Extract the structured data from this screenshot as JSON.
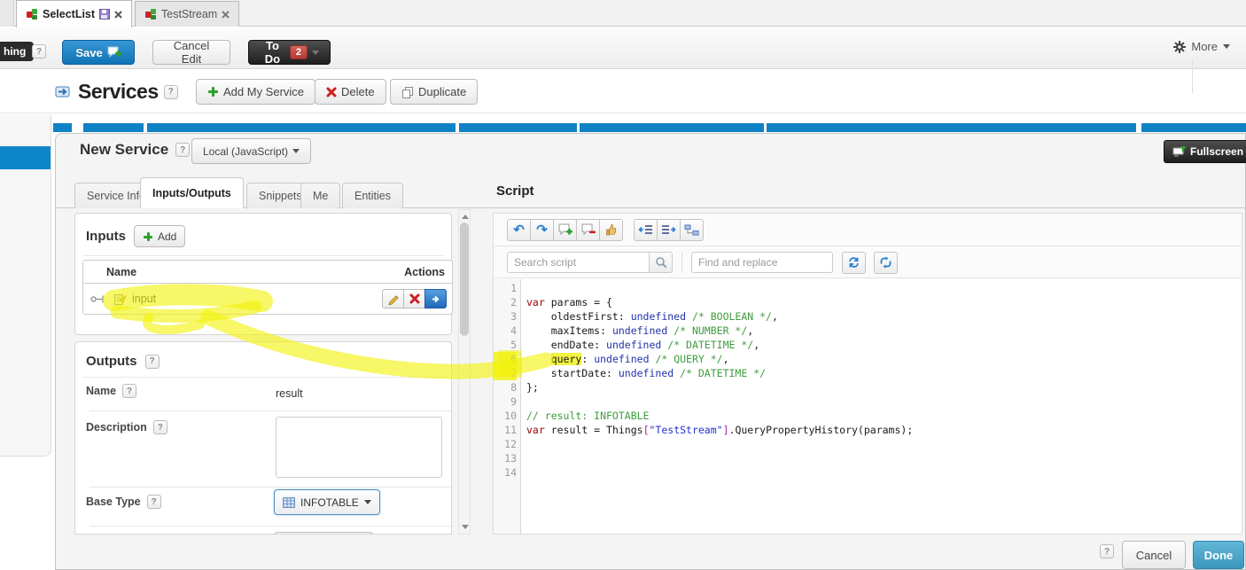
{
  "ui": {
    "help": "?"
  },
  "window_tabs": [
    {
      "label": "SelectList",
      "modified": true
    },
    {
      "label": "TestStream",
      "modified": false
    }
  ],
  "toolbar": {
    "entity_label_partial": "hing",
    "save": "Save",
    "cancel_edit": "Cancel Edit",
    "todo": "To Do",
    "todo_count": "2",
    "more": "More"
  },
  "services_header": {
    "title": "Services",
    "add_my_service": "Add My Service",
    "delete": "Delete",
    "duplicate": "Duplicate"
  },
  "editor": {
    "title": "New Service",
    "language": "Local (JavaScript)",
    "fullscreen": "Fullscreen",
    "tabs": [
      {
        "label": "Service Info"
      },
      {
        "label": "Inputs/Outputs"
      },
      {
        "label": "Snippets"
      },
      {
        "label": "Me"
      },
      {
        "label": "Entities"
      }
    ],
    "active_tab": "Inputs/Outputs"
  },
  "inputs": {
    "heading": "Inputs",
    "add": "Add",
    "columns": {
      "name": "Name",
      "actions": "Actions"
    },
    "rows": [
      {
        "name": "input"
      }
    ]
  },
  "outputs": {
    "heading": "Outputs",
    "name_label": "Name",
    "name_value": "result",
    "description_label": "Description",
    "description_value": "",
    "base_type_label": "Base Type",
    "base_type_value": "INFOTABLE"
  },
  "script": {
    "heading": "Script",
    "search_placeholder": "Search script",
    "replace_placeholder": "Find and replace",
    "icons": {
      "undo": "↶",
      "redo": "↷"
    },
    "code": {
      "line_count": 14,
      "highlighted_gutter_lines": [
        6,
        7
      ],
      "lines": [
        [],
        [
          [
            "kw",
            "var"
          ],
          [
            "pln",
            " params = {"
          ]
        ],
        [
          [
            "pln",
            "    oldestFirst: "
          ],
          [
            "atom",
            "undefined"
          ],
          [
            "pln",
            " "
          ],
          [
            "com",
            "/* BOOLEAN */"
          ],
          [
            "pln",
            ","
          ]
        ],
        [
          [
            "pln",
            "    maxItems: "
          ],
          [
            "atom",
            "undefined"
          ],
          [
            "pln",
            " "
          ],
          [
            "com",
            "/* NUMBER */"
          ],
          [
            "pln",
            ","
          ]
        ],
        [
          [
            "pln",
            "    endDate: "
          ],
          [
            "atom",
            "undefined"
          ],
          [
            "pln",
            " "
          ],
          [
            "com",
            "/* DATETIME */"
          ],
          [
            "pln",
            ","
          ]
        ],
        [
          [
            "pln",
            "    "
          ],
          [
            "hl",
            "query"
          ],
          [
            "pln",
            ": "
          ],
          [
            "atom",
            "undefined"
          ],
          [
            "pln",
            " "
          ],
          [
            "com",
            "/* QUERY */"
          ],
          [
            "pln",
            ","
          ]
        ],
        [
          [
            "pln",
            "    startDate: "
          ],
          [
            "atom",
            "undefined"
          ],
          [
            "pln",
            " "
          ],
          [
            "com",
            "/* DATETIME */"
          ]
        ],
        [
          [
            "pln",
            "};"
          ]
        ],
        [],
        [
          [
            "com",
            "// result: INFOTABLE"
          ]
        ],
        [
          [
            "kw",
            "var"
          ],
          [
            "pln",
            " result = Things"
          ],
          [
            "brk",
            "["
          ],
          [
            "str",
            "\"TestStream\""
          ],
          [
            "brk",
            "]"
          ],
          [
            "pln",
            ".QueryPropertyHistory(params);"
          ]
        ],
        [],
        [],
        []
      ]
    }
  },
  "footer": {
    "cancel": "Cancel",
    "done": "Done"
  },
  "colors": {
    "accent_blue": "#0f82c5",
    "selection_blue": "#0c86c9",
    "save_button_blue": "#1b7fc4",
    "done_teal": "#45a5c9",
    "badge_red": "#b03a30",
    "highlight_yellow": "#f2f20a",
    "code_keyword": "#990000",
    "code_atom": "#2233aa",
    "code_comment": "#3f9b3f",
    "code_string": "#2233cc",
    "code_bracket": "#aa22aa"
  }
}
